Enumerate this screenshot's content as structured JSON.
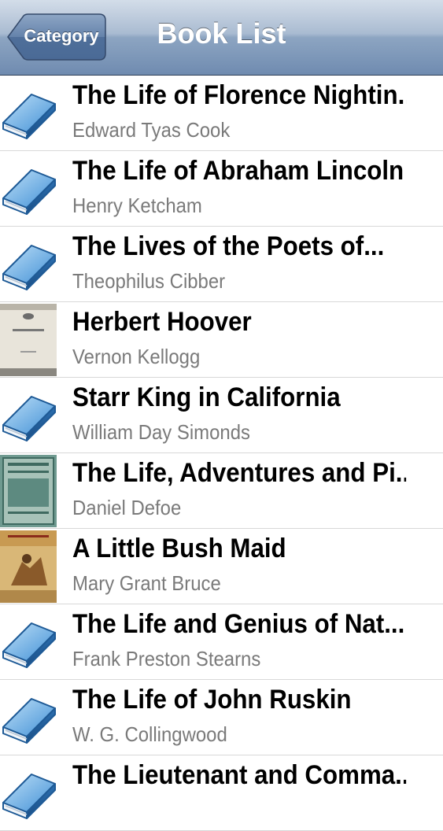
{
  "navbar": {
    "back_label": "Category",
    "title": "Book List"
  },
  "books": [
    {
      "title": "The Life of Florence Nightin...",
      "author": "Edward Tyas Cook",
      "thumb": "book-icon"
    },
    {
      "title": "The Life of Abraham Lincoln",
      "author": "Henry Ketcham",
      "thumb": "book-icon"
    },
    {
      "title": "The Lives of the Poets of...",
      "author": "Theophilus Cibber",
      "thumb": "book-icon"
    },
    {
      "title": "Herbert Hoover",
      "author": "Vernon Kellogg",
      "thumb": "cover-image"
    },
    {
      "title": "Starr King in California",
      "author": "William Day Simonds",
      "thumb": "book-icon"
    },
    {
      "title": "The Life, Adventures and Pi...",
      "author": "Daniel Defoe",
      "thumb": "cover-image"
    },
    {
      "title": "A Little Bush Maid",
      "author": "Mary Grant Bruce",
      "thumb": "cover-image"
    },
    {
      "title": "The Life and Genius of Nat...",
      "author": "Frank Preston Stearns",
      "thumb": "book-icon"
    },
    {
      "title": "The Life of John Ruskin",
      "author": "W. G. Collingwood",
      "thumb": "book-icon"
    },
    {
      "title": "The Lieutenant and Comma...",
      "author": "",
      "thumb": "book-icon"
    }
  ]
}
